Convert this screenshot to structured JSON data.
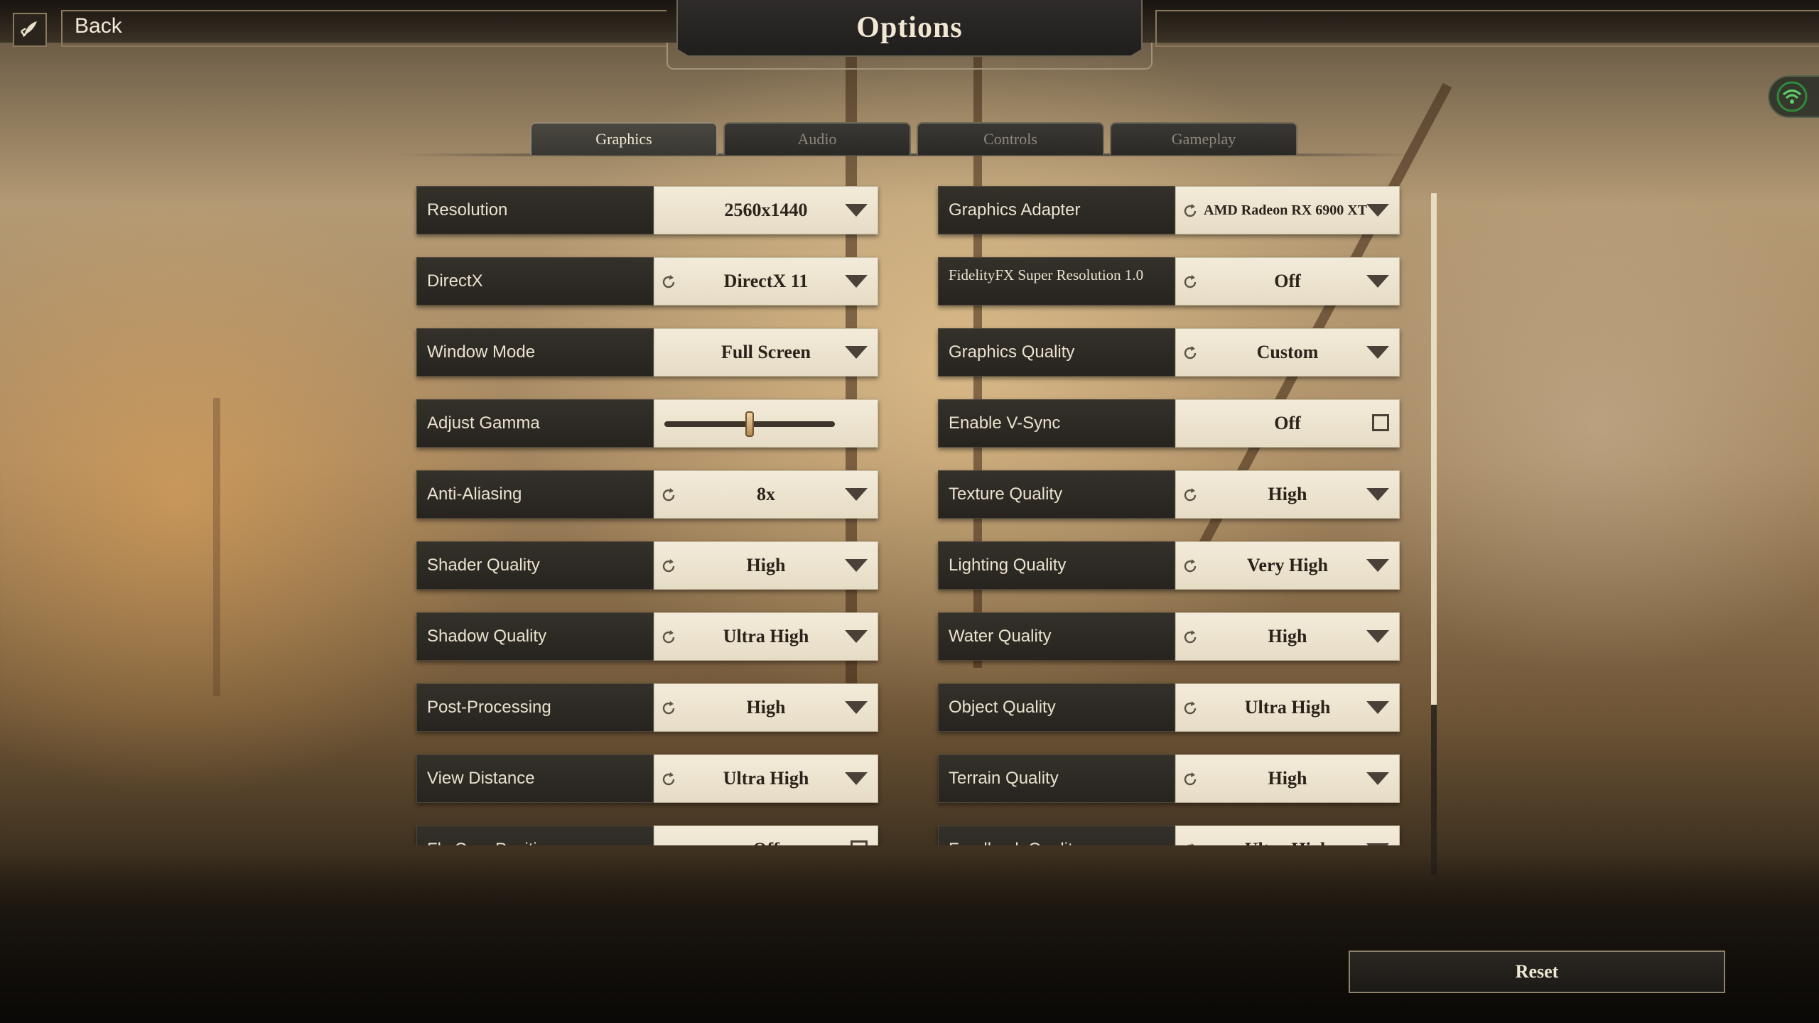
{
  "header": {
    "back_label": "Back",
    "title": "Options"
  },
  "tabs": [
    {
      "label": "Graphics",
      "active": true
    },
    {
      "label": "Audio",
      "active": false
    },
    {
      "label": "Controls",
      "active": false
    },
    {
      "label": "Gameplay",
      "active": false
    }
  ],
  "settings": {
    "left": [
      {
        "label": "Resolution",
        "value": "2560x1440",
        "type": "dropdown",
        "refresh": false
      },
      {
        "label": "DirectX",
        "value": "DirectX 11",
        "type": "dropdown",
        "refresh": true
      },
      {
        "label": "Window Mode",
        "value": "Full Screen",
        "type": "dropdown",
        "refresh": false
      },
      {
        "label": "Adjust Gamma",
        "value": "",
        "type": "slider",
        "slider_fraction": 0.5
      },
      {
        "label": "Anti-Aliasing",
        "value": "8x",
        "type": "dropdown",
        "refresh": true
      },
      {
        "label": "Shader Quality",
        "value": "High",
        "type": "dropdown",
        "refresh": true
      },
      {
        "label": "Shadow Quality",
        "value": "Ultra High",
        "type": "dropdown",
        "refresh": true
      },
      {
        "label": "Post-Processing",
        "value": "High",
        "type": "dropdown",
        "refresh": true
      },
      {
        "label": "View Distance",
        "value": "Ultra High",
        "type": "dropdown",
        "refresh": true
      },
      {
        "label": "Fly Cam Position",
        "value": "Off",
        "type": "checkbox",
        "refresh": false
      }
    ],
    "right": [
      {
        "label": "Graphics Adapter",
        "value": "AMD Radeon RX 6900 XT",
        "type": "dropdown",
        "refresh": true
      },
      {
        "label": "FidelityFX Super Resolution 1.0",
        "value": "Off",
        "type": "dropdown",
        "refresh": true
      },
      {
        "label": "Graphics Quality",
        "value": "Custom",
        "type": "dropdown",
        "refresh": true
      },
      {
        "label": "Enable V-Sync",
        "value": "Off",
        "type": "checkbox",
        "refresh": false
      },
      {
        "label": "Texture Quality",
        "value": "High",
        "type": "dropdown",
        "refresh": true
      },
      {
        "label": "Lighting Quality",
        "value": "Very High",
        "type": "dropdown",
        "refresh": true
      },
      {
        "label": "Water Quality",
        "value": "High",
        "type": "dropdown",
        "refresh": true
      },
      {
        "label": "Object Quality",
        "value": "Ultra High",
        "type": "dropdown",
        "refresh": true
      },
      {
        "label": "Terrain Quality",
        "value": "High",
        "type": "dropdown",
        "refresh": true
      },
      {
        "label": "Feedback Quality",
        "value": "Ultra High",
        "type": "dropdown",
        "refresh": true
      }
    ]
  },
  "footer": {
    "reset_label": "Reset"
  },
  "colors": {
    "accent": "#efe6d2",
    "control_bg": "#f3ebd9",
    "label_bg": "#2e2a24",
    "status_icon": "#4caf50"
  },
  "icons": {
    "back": "quill-back-icon",
    "refresh": "refresh-icon",
    "dropdown": "chevron-down-icon",
    "status": "wifi-icon"
  }
}
